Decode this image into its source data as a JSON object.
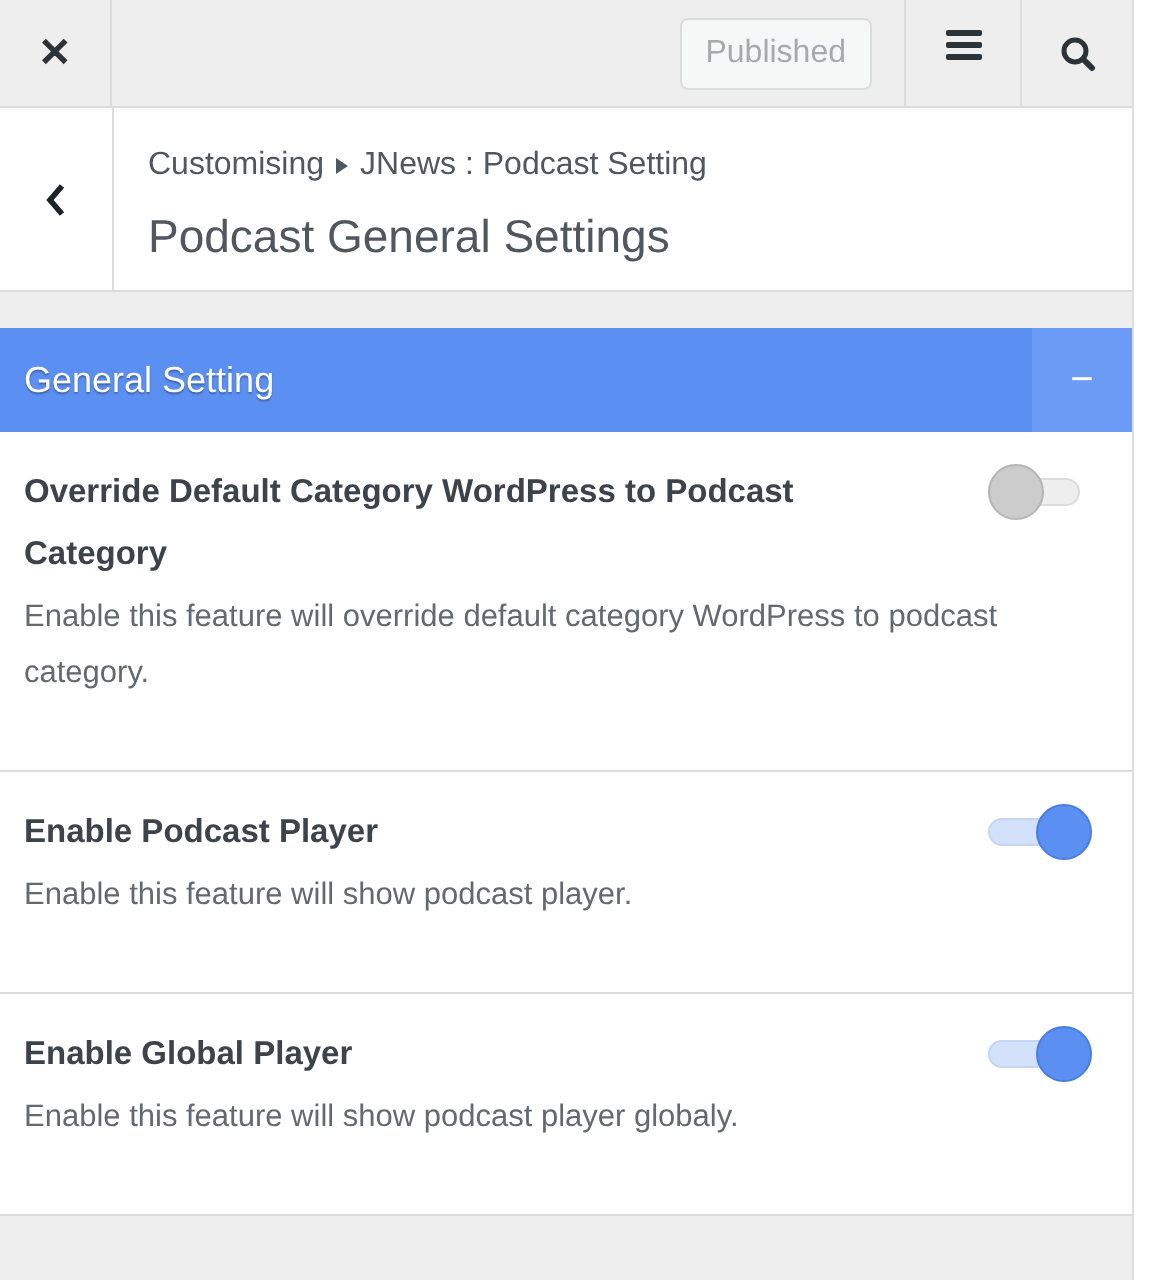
{
  "top_bar": {
    "close": "✕",
    "publish_button": {
      "label": "Published",
      "disabled": true
    }
  },
  "header": {
    "breadcrumb": [
      "Customising",
      "JNews : Podcast Setting"
    ],
    "title": "Podcast General Settings"
  },
  "section": {
    "title": "General Setting",
    "expanded": true,
    "toggle_symbol": "−"
  },
  "settings": [
    {
      "title": "Override Default Category WordPress to Podcast Category",
      "description": "Enable this feature will override default category WordPress to podcast category.",
      "on": false
    },
    {
      "title": "Enable Podcast Player",
      "description": "Enable this feature will show podcast player.",
      "on": true
    },
    {
      "title": "Enable Global Player",
      "description": "Enable this feature will show podcast player globaly.",
      "on": true
    }
  ]
}
